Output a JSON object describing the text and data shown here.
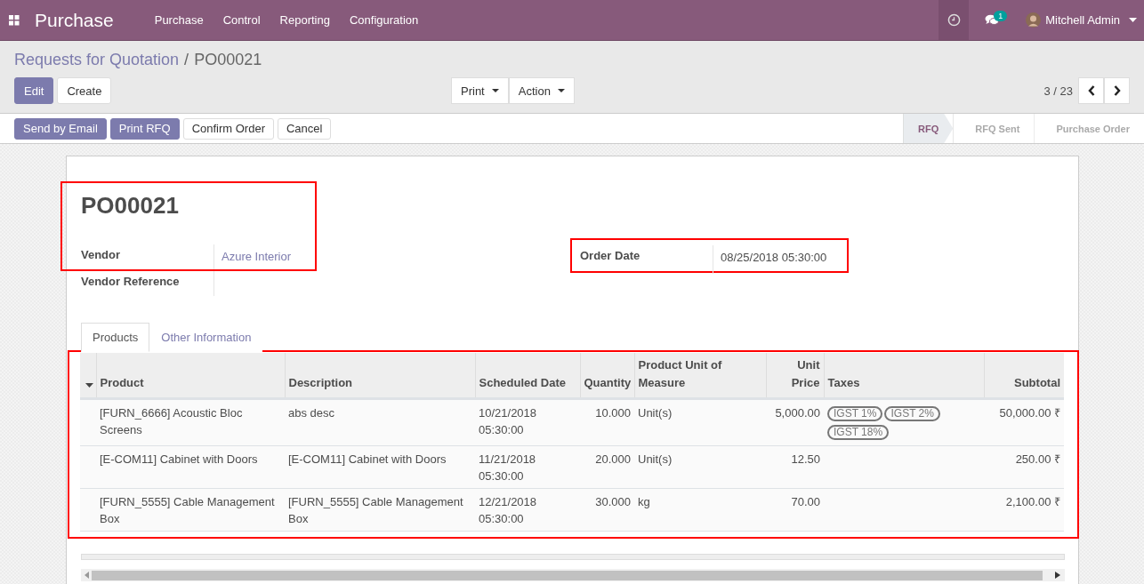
{
  "navbar": {
    "app_name": "Purchase",
    "menu": [
      "Purchase",
      "Control",
      "Reporting",
      "Configuration"
    ],
    "messages_count": "1",
    "user": "Mitchell Admin"
  },
  "breadcrumb": {
    "parent": "Requests for Quotation",
    "separator": "/",
    "current": "PO00021"
  },
  "buttons": [
    {
      "label": "Edit",
      "primary": true
    },
    {
      "label": "Create",
      "primary": false
    }
  ],
  "dropdowns": [
    "Print",
    "Action"
  ],
  "pager": "3 / 23",
  "actions": [
    {
      "label": "Send by Email",
      "primary": true
    },
    {
      "label": "Print RFQ",
      "primary": true
    },
    {
      "label": "Confirm Order",
      "primary": false
    },
    {
      "label": "Cancel",
      "primary": false
    }
  ],
  "stages": [
    {
      "label": "RFQ",
      "selected": true
    },
    {
      "label": "RFQ Sent",
      "selected": false
    },
    {
      "label": "Purchase Order",
      "selected": false
    }
  ],
  "form": {
    "name": "PO00021",
    "header_highlighted": true,
    "vendor": {
      "label": "Vendor",
      "value": "Azure Interior"
    },
    "vendor_reference": {
      "label": "Vendor Reference"
    },
    "order_date": {
      "label": "Order Date",
      "value": "08/25/2018 05:30:00",
      "highlighted": true
    }
  },
  "tabs": [
    {
      "label": "Products",
      "selected": true
    },
    {
      "label": "Other Information",
      "selected": false
    }
  ],
  "table": {
    "highlighted": true,
    "columns": [
      "Product",
      "Description",
      "Scheduled Date",
      "Quantity",
      "Product Unit of Measure",
      "Unit Price",
      "Taxes",
      "Subtotal"
    ],
    "rows": [
      {
        "product": "[FURN_6666] Acoustic Bloc Screens",
        "description": "abs desc",
        "scheduled_date": "10/21/2018 05:30:00",
        "quantity": "10.000",
        "uom": "Unit(s)",
        "unit_price": "5,000.00",
        "taxes": [
          "IGST 1%",
          "IGST 2%",
          "IGST 18%"
        ],
        "subtotal": "50,000.00 ₹"
      },
      {
        "product": "[E-COM11] Cabinet with Doors",
        "description": "[E-COM11] Cabinet with Doors",
        "scheduled_date": "11/21/2018 05:30:00",
        "quantity": "20.000",
        "uom": "Unit(s)",
        "unit_price": "12.50",
        "subtotal": "250.00 ₹"
      },
      {
        "product": "[FURN_5555] Cable Management Box",
        "description": "[FURN_5555] Cable Management Box",
        "scheduled_date": "12/21/2018 05:30:00",
        "quantity": "30.000",
        "uom": "kg",
        "unit_price": "70.00",
        "subtotal": "2,100.00 ₹"
      }
    ]
  }
}
